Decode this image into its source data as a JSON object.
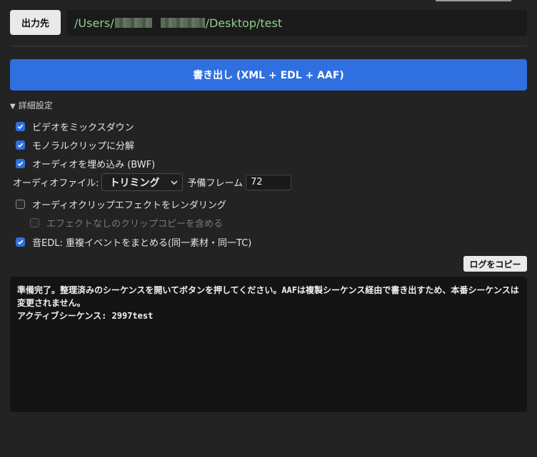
{
  "output": {
    "button_label": "出力先",
    "path_prefix": "/Users/",
    "path_suffix": "/Desktop/test"
  },
  "export_button": "書き出し (XML + EDL + AAF)",
  "details_label": "詳細設定",
  "options": {
    "mixdown": {
      "label": "ビデオをミックスダウン",
      "checked": true
    },
    "split_mono": {
      "label": "モノラルクリップに分解",
      "checked": true
    },
    "embed_audio": {
      "label": "オーディオを埋め込み (BWF)",
      "checked": true
    }
  },
  "audio_file": {
    "label": "オーディオファイル:",
    "select_value": "トリミング",
    "handle_label": "予備フレーム",
    "handle_value": "72"
  },
  "render_effects": {
    "label": "オーディオクリップエフェクトをレンダリング",
    "checked": false
  },
  "include_copies": {
    "label": "エフェクトなしのクリップコピーを含める",
    "checked": false,
    "disabled": true
  },
  "sound_edl": {
    "label": "音EDL: 重複イベントをまとめる(同一素材・同一TC)",
    "checked": true
  },
  "copy_log_button": "ログをコピー",
  "log": {
    "line1": "準備完了。整理済みのシーケンスを開いてボタンを押してください。AAFは複製シーケンス経由で書き出すため、本番シーケンスは",
    "line2": "変更されません。",
    "line3": "アクティブシーケンス: 2997test"
  },
  "colors": {
    "accent": "#2f6fe0",
    "path_text": "#8fd18a"
  }
}
